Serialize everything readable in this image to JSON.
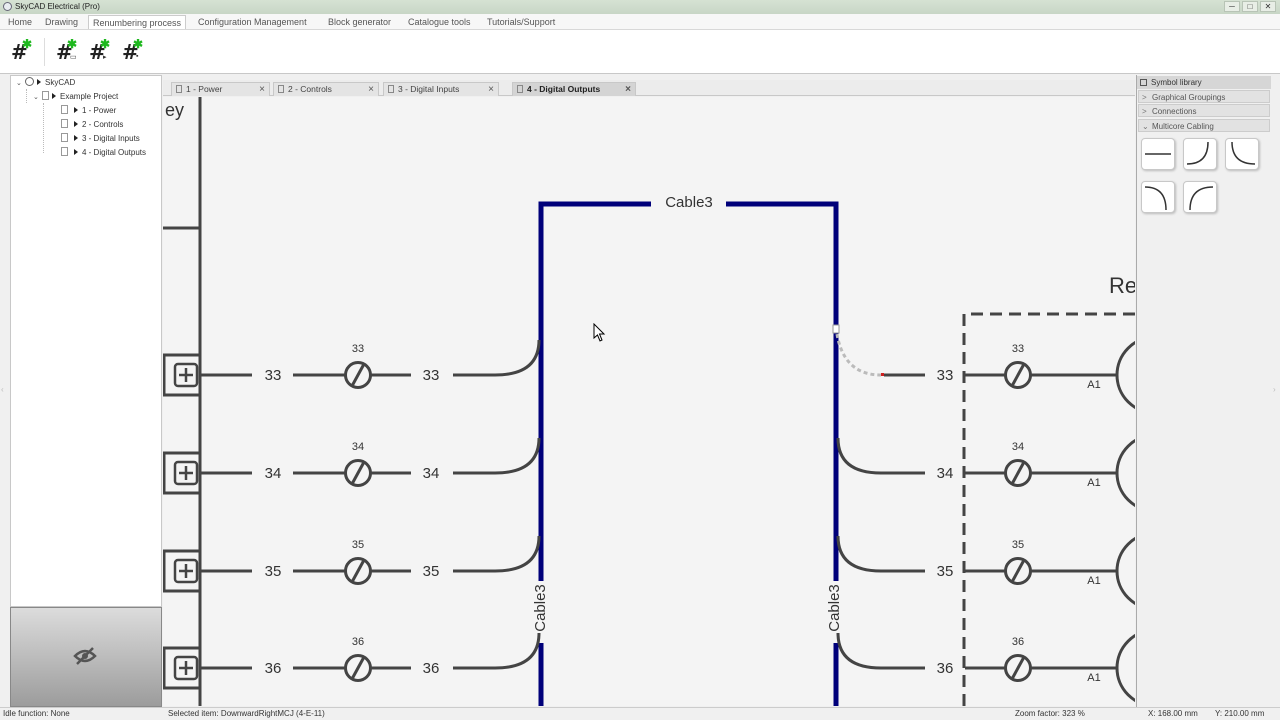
{
  "window": {
    "title": "SkyCAD Electrical (Pro)",
    "minimize": "─",
    "maximize": "□",
    "close": "✕"
  },
  "menu": {
    "home": "Home",
    "drawing": "Drawing",
    "renumbering": "Renumbering process",
    "config": "Configuration Management",
    "block": "Block generator",
    "catalogue": "Catalogue tools",
    "tutorials": "Tutorials/Support",
    "active": "Renumbering process"
  },
  "ribbon": {
    "icons": [
      {
        "name": "renumber-new-icon",
        "glyph": "#",
        "badge": "✱"
      },
      {
        "name": "renumber-page-icon",
        "glyph": "#",
        "badge": "✱"
      },
      {
        "name": "renumber-sequence-icon",
        "glyph": "#",
        "badge": "✱"
      },
      {
        "name": "renumber-selection-icon",
        "glyph": "#",
        "badge": "✱"
      }
    ],
    "accent": "#1fb81f"
  },
  "tree": {
    "root": "SkyCAD",
    "project": "Example Project",
    "pages": [
      "1 - Power",
      "2 - Controls",
      "3 - Digital Inputs",
      "4 - Digital Outputs"
    ]
  },
  "tabs": [
    "1 - Power",
    "2 - Controls",
    "3 - Digital Inputs",
    "4 - Digital Outputs"
  ],
  "active_tab": "4 - Digital Outputs",
  "drawing": {
    "cable_label": "Cable3",
    "partial_left_text": "ey",
    "partial_right_text": "Re",
    "wires": [
      "33",
      "34",
      "35",
      "36"
    ],
    "coil_label": "A1",
    "cable_color": "#00007a",
    "wire_color": "#444444"
  },
  "library": {
    "title": "Symbol library",
    "sections": [
      "Graphical Groupings",
      "Connections",
      "Multicore Cabling"
    ],
    "expanded": "Multicore Cabling",
    "symbols": [
      "straight-cable-symbol",
      "curve-up-right-symbol",
      "curve-down-left-symbol",
      "curve-down-right-symbol",
      "curve-up-left-symbol"
    ]
  },
  "status": {
    "function": "Idle function: None",
    "selected": "Selected item: DownwardRightMCJ (4-E-11)",
    "zoom": "Zoom factor: 323 %",
    "x": "X: 168.00 mm",
    "y": "Y: 210.00 mm"
  }
}
